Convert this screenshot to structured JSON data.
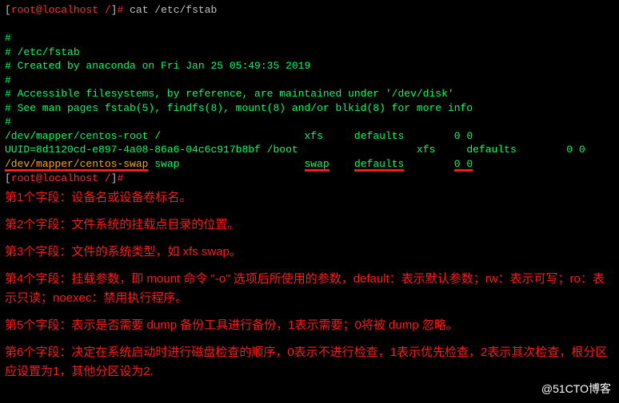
{
  "prompt": {
    "user_host": "root@localhost",
    "cwd": "/",
    "symbol": "#",
    "command": "cat /etc/fstab"
  },
  "fstab": {
    "lines": [
      "#",
      "# /etc/fstab",
      "# Created by anaconda on Fri Jan 25 05:49:35 2019",
      "#",
      "# Accessible filesystems, by reference, are maintained under '/dev/disk'",
      "# See man pages fstab(5), findfs(8), mount(8) and/or blkid(8) for more info",
      "#"
    ],
    "entries": [
      {
        "device": "/dev/mapper/centos-root",
        "mount": "/",
        "type": "xfs",
        "opts": "defaults",
        "dump": "0",
        "pass": "0"
      },
      {
        "device": "UUID=8d1120cd-e897-4a08-86a6-04c6c917b8bf",
        "mount": "/boot",
        "type": "xfs",
        "opts": "defaults",
        "dump": "0",
        "pass": "0"
      },
      {
        "device": "/dev/mapper/centos-swap",
        "mount": "swap",
        "type": "swap",
        "opts": "defaults",
        "dump": "0",
        "pass": "0"
      }
    ]
  },
  "prompt2": {
    "user_host": "root@localhost",
    "cwd": "/",
    "symbol": "#"
  },
  "annotations": [
    "第1个字段：设备名或设备卷标名。",
    "第2个字段：文件系统的挂载点目录的位置。",
    "第3个字段：文件的系统类型，如 xfs  swap。",
    "第4个字段：挂载参数，即 mount 命令 \"-o\" 选项后所使用的参数，default：表示默认参数；rw：表示可写；ro：表示只读；noexec：禁用执行程序。",
    "第5个字段：表示是否需要 dump 备份工具进行备份，1表示需要；0将被 dump 忽略。",
    "第6个字段：决定在系统启动时进行磁盘检查的顺序，0表示不进行检查，1表示优先检查，2表示其次检查，根分区应设置为1，其他分区设为2."
  ],
  "watermark": "@51CTO博客"
}
